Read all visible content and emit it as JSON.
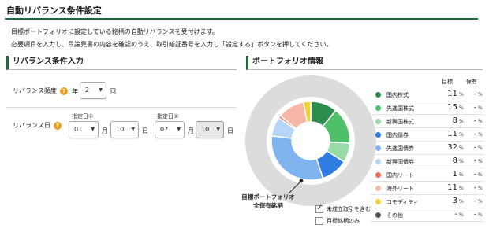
{
  "header": {
    "title": "自動リバランス条件設定",
    "intro_line1": "目標ポートフォリオに設定している銘柄の自動リバランスを受付けます。",
    "intro_line2": "必要項目を入力し、目論見書の内容を確認のうえ、取引暗証番号を入力し「設定する」ボタンを押してください。"
  },
  "conditions": {
    "section_title": "リバランス条件入力",
    "frequency": {
      "label": "リバランス頻度",
      "prefix": "年",
      "value": "2",
      "unit": "回"
    },
    "date": {
      "label": "リバランス日",
      "date1_label": "指定日①",
      "date1_month": "01",
      "date1_day": "10",
      "date2_label": "指定日②",
      "date2_month": "07",
      "date2_day": "10",
      "month_unit": "月",
      "day_unit": "日"
    }
  },
  "portfolio": {
    "section_title": "ポートフォリオ情報",
    "col_target": "目標",
    "col_holding": "保有",
    "pct": "%",
    "caption_line1": "目標ポートフォリオ",
    "caption_line2": "全保有銘柄",
    "check_pending": "未成立取引を含む",
    "check_target_only": "目標銘柄のみ",
    "check_pending_checked": true,
    "check_target_only_checked": false,
    "items": [
      {
        "name": "国内株式",
        "target": "11",
        "holding": "-",
        "color": "#2e8b4e"
      },
      {
        "name": "先進国株式",
        "target": "15",
        "holding": "-",
        "color": "#4fbf6a"
      },
      {
        "name": "新興国株式",
        "target": "8",
        "holding": "-",
        "color": "#96dba8"
      },
      {
        "name": "国内債券",
        "target": "11",
        "holding": "-",
        "color": "#2f7de0"
      },
      {
        "name": "先進国債券",
        "target": "32",
        "holding": "-",
        "color": "#7fb4f0"
      },
      {
        "name": "新興国債券",
        "target": "8",
        "holding": "-",
        "color": "#b7d6f7"
      },
      {
        "name": "国内リート",
        "target": "1",
        "holding": "-",
        "color": "#f06a55"
      },
      {
        "name": "海外リート",
        "target": "11",
        "holding": "-",
        "color": "#f7b7a6"
      },
      {
        "name": "コモディティ",
        "target": "3",
        "holding": "-",
        "color": "#f2d230"
      },
      {
        "name": "その他",
        "target": "-",
        "holding": "-",
        "color": "#555555"
      }
    ]
  }
}
